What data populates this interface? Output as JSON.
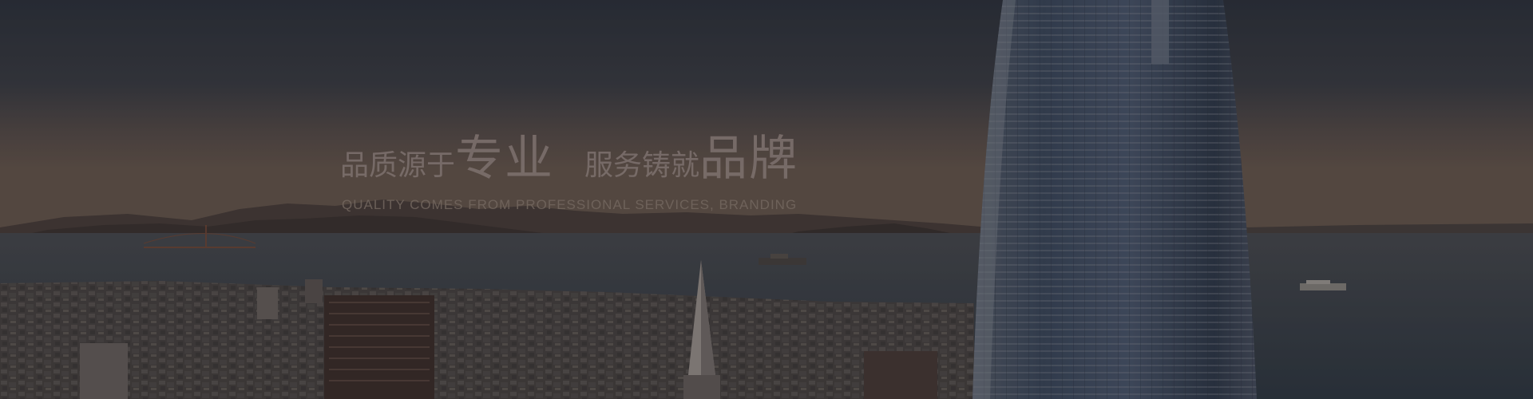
{
  "banner": {
    "slogan": {
      "part1_small": "品质源于",
      "part1_big": "专业",
      "part2_small": "服务铸就",
      "part2_big": "品牌",
      "subtitle": "QUALITY COMES FROM PROFESSIONAL SERVICES, BRANDING"
    },
    "colors": {
      "sky_top": "#2f343d",
      "sky_horizon": "#6a5a4f",
      "water": "#3a4149",
      "hills": "#3d3430",
      "tower_glass": "#4a5668",
      "slogan_text": "#7b6f6c"
    }
  }
}
